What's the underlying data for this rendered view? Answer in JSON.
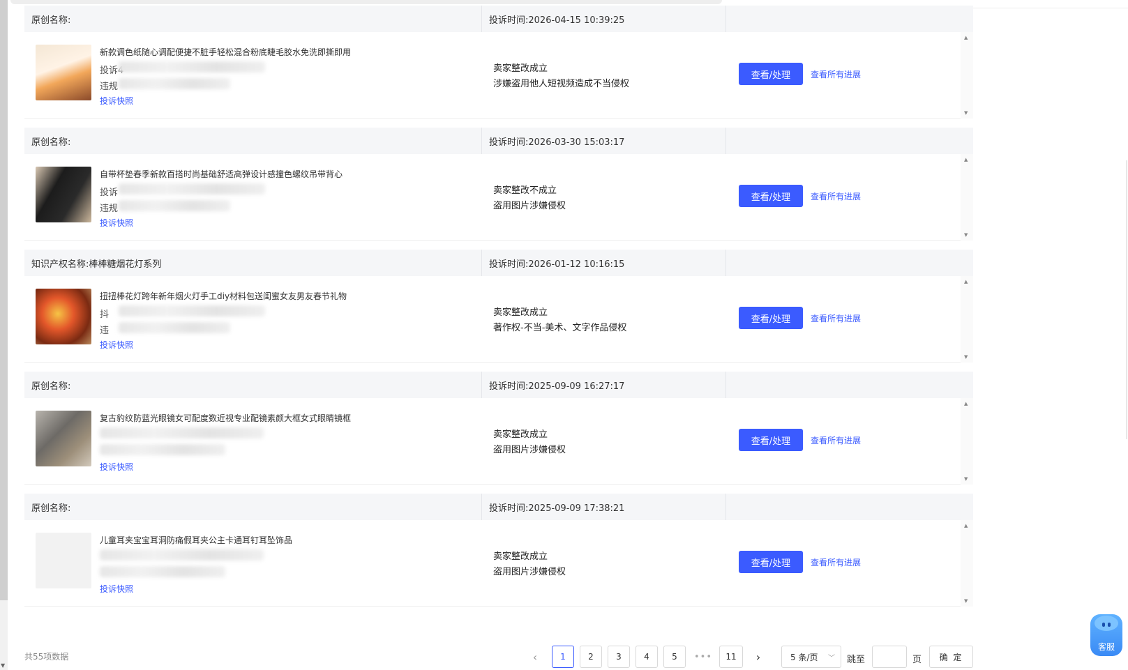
{
  "complaints": [
    {
      "name_label": "原创名称:",
      "time_label": "投诉时间:2026-04-15 10:39:25",
      "product_title": "新款调色纸随心调配便捷不脏手轻松混合粉底睫毛胶水免洗即撕即用",
      "line1_prefix": "投诉4",
      "line2_prefix": "违规",
      "snapshot": "投诉快照",
      "status": "卖家整改成立",
      "reason": "涉嫌盗用他人短视频造成不当侵权",
      "view_button": "查看/处理",
      "progress_link": "查看所有进展"
    },
    {
      "name_label": "原创名称:",
      "time_label": "投诉时间:2026-03-30 15:03:17",
      "product_title": "自带杯垫春季新款百搭时尚基础舒适高弹设计感撞色螺纹吊带背心",
      "line1_prefix": "投诉",
      "line2_prefix": "违规",
      "snapshot": "投诉快照",
      "status": "卖家整改不成立",
      "reason": "盗用图片涉嫌侵权",
      "view_button": "查看/处理",
      "progress_link": "查看所有进展"
    },
    {
      "name_label": "知识产权名称:棒棒糖烟花灯系列",
      "time_label": "投诉时间:2026-01-12 10:16:15",
      "product_title": "扭扭棒花灯跨年新年烟火灯手工diy材料包送闺蜜女友男友春节礼物",
      "line1_prefix": "抖",
      "line2_prefix": "违",
      "snapshot": "投诉快照",
      "status": "卖家整改成立",
      "reason": "著作权-不当-美术、文字作品侵权",
      "view_button": "查看/处理",
      "progress_link": "查看所有进展"
    },
    {
      "name_label": "原创名称:",
      "time_label": "投诉时间:2025-09-09 16:27:17",
      "product_title": "复古豹纹防蓝光眼镜女可配度数近视专业配镜素颜大框女式眼睛镜框",
      "line1_prefix": "",
      "line2_prefix": "",
      "snapshot": "投诉快照",
      "status": "卖家整改成立",
      "reason": "盗用图片涉嫌侵权",
      "view_button": "查看/处理",
      "progress_link": "查看所有进展"
    },
    {
      "name_label": "原创名称:",
      "time_label": "投诉时间:2025-09-09 17:38:21",
      "product_title": "儿童耳夹宝宝耳洞防痛假耳夹公主卡通耳钉耳坠饰品",
      "line1_prefix": "",
      "line2_prefix": "",
      "snapshot": "投诉快照",
      "status": "卖家整改成立",
      "reason": "盗用图片涉嫌侵权",
      "view_button": "查看/处理",
      "progress_link": "查看所有进展"
    }
  ],
  "pagination": {
    "total": "共55项数据",
    "prev_icon": "‹",
    "next_icon": "›",
    "pages": [
      "1",
      "2",
      "3",
      "4",
      "5"
    ],
    "ellipsis": "•••",
    "last_page": "11",
    "current_page": "1",
    "page_size": "5 条/页",
    "jump_label": "跳至",
    "jump_value": "",
    "page_label": "页",
    "confirm": "确 定"
  },
  "service_widget": {
    "label": "客服",
    "icon": "robot-mascot-icon"
  },
  "colors": {
    "accent": "#3b5bff",
    "header_bg": "#f5f6f8"
  }
}
